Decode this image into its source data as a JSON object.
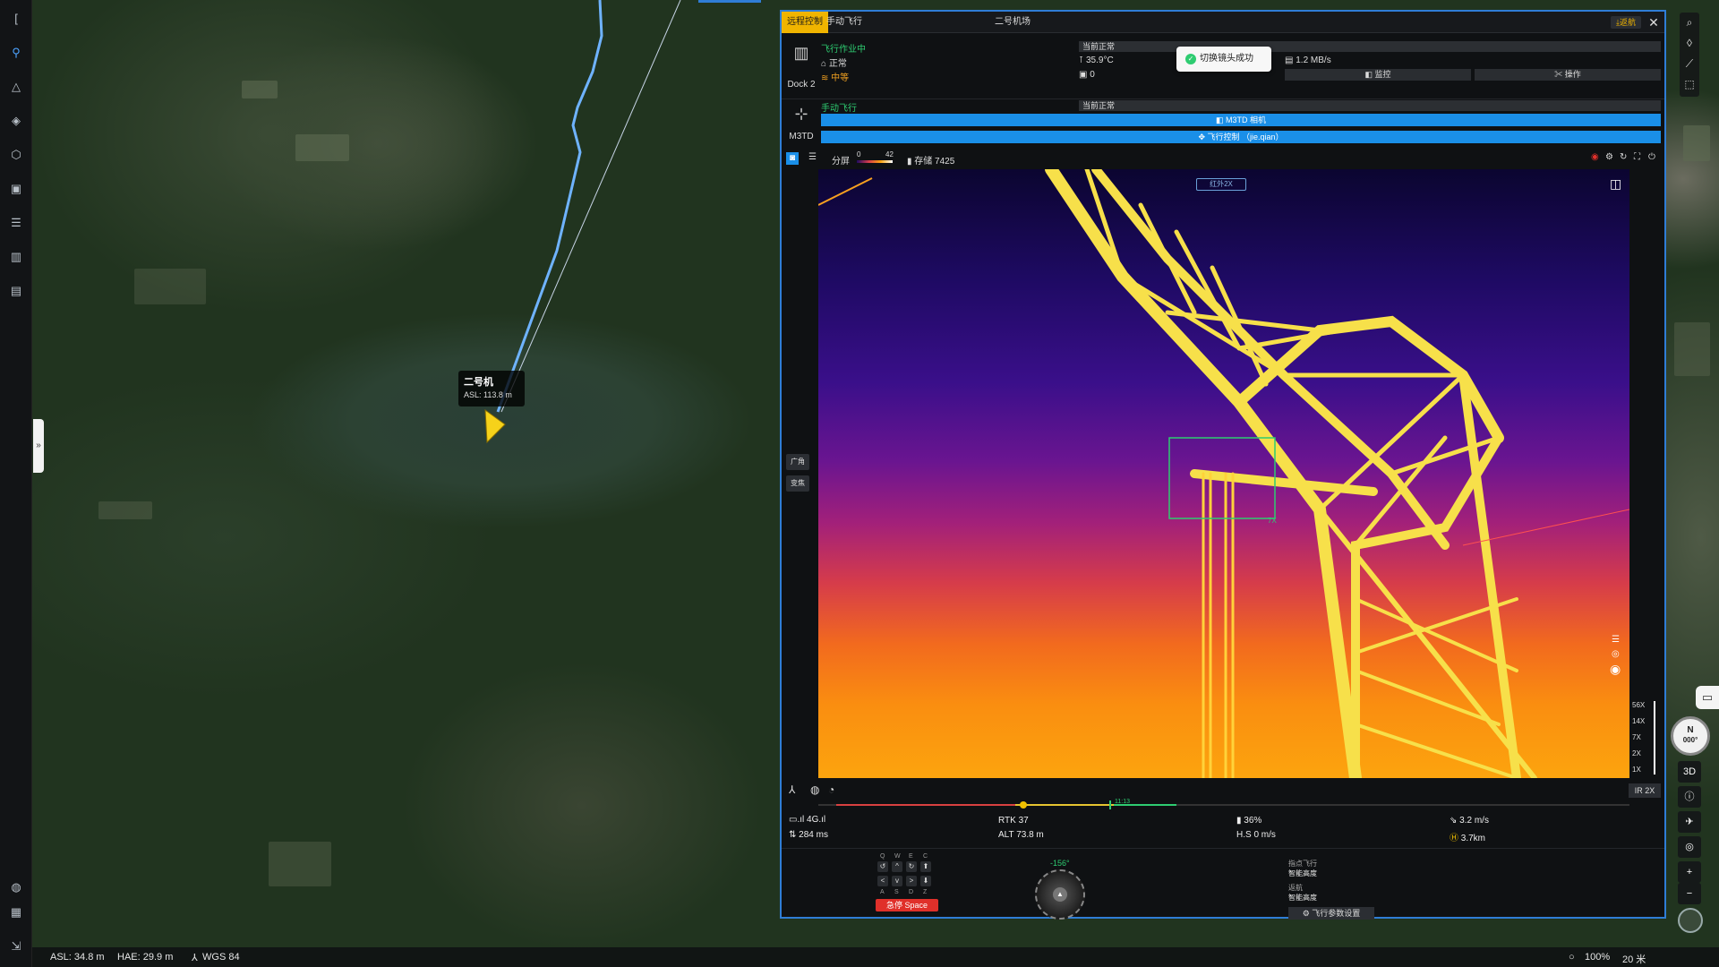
{
  "map": {
    "drone_tag": {
      "name": "二号机",
      "asl": "ASL: 113.8 m"
    }
  },
  "status_bar": {
    "asl": "ASL: 34.8 m",
    "hae": "HAE: 29.9 m",
    "datum": "WGS 84",
    "zoom_pct": "100%",
    "scale": "20 米"
  },
  "right_controls": {
    "three_d": "3D",
    "plus": "+",
    "minus": "−",
    "compass_n": "N",
    "compass_deg": "000°"
  },
  "panel": {
    "tabs": [
      "远程控制",
      "手动飞行",
      "二号机场"
    ],
    "return_label": "返航",
    "dock": {
      "device_name": "Dock 2",
      "state": "飞行作业中",
      "status": "正常",
      "wind": "中等",
      "temp": "35.9°C",
      "count": "0",
      "speed": "1.2 MB/s",
      "current": "当前正常",
      "monitor_btn": "监控",
      "operate_btn": "操作"
    },
    "toast": "切换镜头成功",
    "drone": {
      "device_name": "M3TD",
      "mode": "手动飞行",
      "current": "当前正常",
      "camera_btn": "M3TD 相机",
      "control_btn": "飞行控制 （jie.qian）"
    },
    "video_toolbar": {
      "split": "分屏",
      "range_min": "0",
      "range_max": "42",
      "storage": "存储 7425"
    },
    "video": {
      "ir_label": "红外2X",
      "wide_btn": "广角",
      "zoom_btn": "变焦",
      "box_zoom": "7X",
      "zoom_levels": [
        "56X",
        "14X",
        "7X",
        "2X",
        "1X"
      ],
      "ir_zoom": "IR 2X",
      "timeline_time": "11:13"
    },
    "telemetry": {
      "signal": "4G",
      "latency": "284 ms",
      "rtk": "RTK 37",
      "alt": "ALT 73.8 m",
      "battery": "36%",
      "hspeed": "H.S 0 m/s",
      "vspeed": "3.2 m/s",
      "distance": "3.7km"
    },
    "controls": {
      "keys_top": [
        "Q",
        "W",
        "E",
        "C"
      ],
      "keys_bottom": [
        "A",
        "S",
        "D",
        "Z"
      ],
      "estop": "急停 Space",
      "heading": "-156°",
      "fly_to": "指点飞行",
      "smart_alt": "智能高度",
      "rth": "返航",
      "smart_alt2": "智能高度",
      "params_btn": "飞行参数设置"
    }
  }
}
